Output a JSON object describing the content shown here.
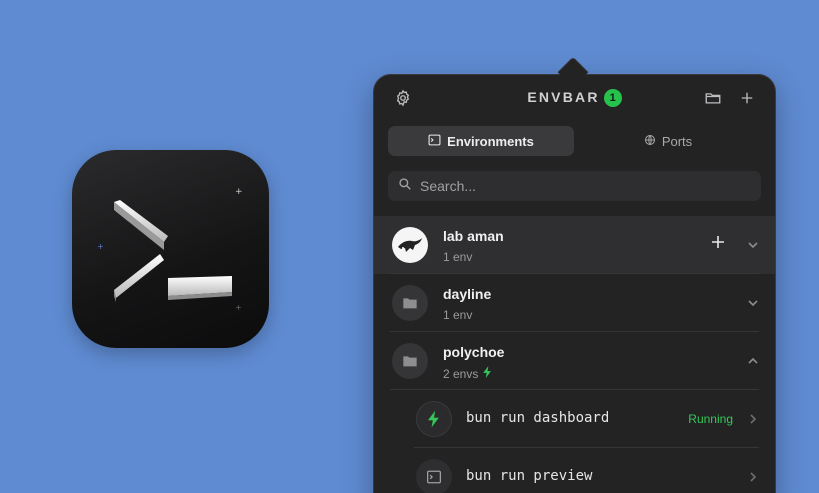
{
  "app_icon": {
    "name": "terminal-app-icon"
  },
  "popover": {
    "title": "ENVBAR",
    "badge_count": "1",
    "header_icons": [
      "gear-icon",
      "folder-icon",
      "plus-icon"
    ],
    "tabs": [
      {
        "label": "Environments",
        "icon": "terminal-icon",
        "active": true
      },
      {
        "label": "Ports",
        "icon": "globe-icon",
        "active": false
      }
    ],
    "search": {
      "placeholder": "Search...",
      "value": ""
    },
    "projects": [
      {
        "name": "lab aman",
        "sub": "1 env",
        "avatar": "image",
        "expanded": false
      },
      {
        "name": "dayline",
        "sub": "1 env",
        "avatar": "folder-icon",
        "expanded": false
      },
      {
        "name": "polychoe",
        "sub": "2 envs",
        "avatar": "folder-icon",
        "expanded": true
      }
    ],
    "commands": [
      {
        "cmd": "bun run dashboard",
        "status": "Running",
        "icon": "bolt-icon"
      },
      {
        "cmd": "bun run preview",
        "status": "",
        "icon": "terminal-icon"
      }
    ],
    "colors": {
      "accent_green": "#35c759",
      "badge": "#27c24c",
      "background": "#232324",
      "desktop": "#5f8bd2"
    }
  }
}
